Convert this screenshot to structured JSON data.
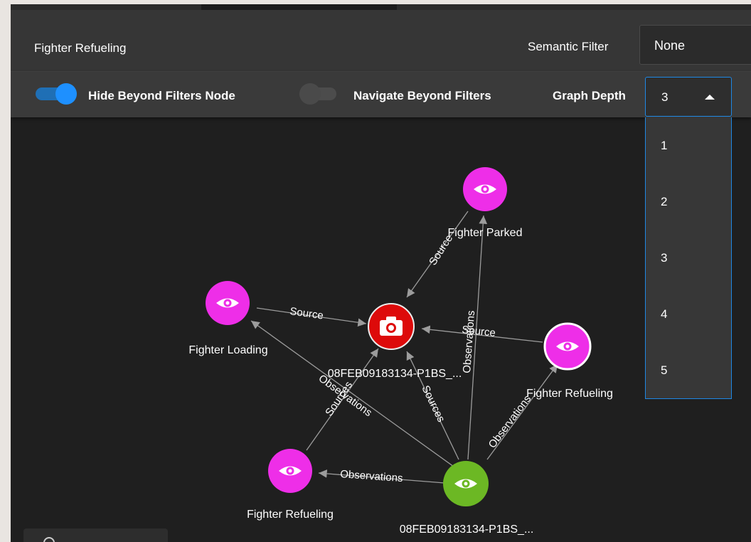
{
  "header": {
    "title": "Fighter Refueling",
    "semantic_filter_label": "Semantic Filter",
    "semantic_filter_value": "None"
  },
  "toolbar": {
    "hide_beyond_label": "Hide Beyond Filters Node",
    "hide_beyond_on": true,
    "navigate_beyond_label": "Navigate Beyond Filters",
    "navigate_beyond_on": false,
    "graph_depth_label": "Graph Depth",
    "graph_depth_value": "3",
    "graph_depth_options": [
      "1",
      "2",
      "3",
      "4",
      "5"
    ]
  },
  "graph": {
    "nodes": {
      "fighter_parked": {
        "label": "Fighter Parked",
        "icon": "eye-icon",
        "color": "#ee2ee8"
      },
      "fighter_loading": {
        "label": "Fighter Loading",
        "icon": "eye-icon",
        "color": "#ee2ee8"
      },
      "image_source": {
        "label": "08FEB09183134-P1BS_...",
        "icon": "camera-icon",
        "color": "#dd0a0a"
      },
      "fighter_refueling_right": {
        "label": "Fighter Refueling",
        "icon": "eye-icon",
        "color": "#ee2ee8"
      },
      "fighter_refueling_left": {
        "label": "Fighter Refueling",
        "icon": "eye-icon",
        "color": "#ee2ee8"
      },
      "center_observation": {
        "label": "08FEB09183134-P1BS_...",
        "icon": "eye-icon",
        "color": "#6cb824"
      }
    },
    "edge_labels": {
      "parked_source": "Source",
      "loading_source": "Source",
      "refueling_source": "Source",
      "center_observations_up": "Observations",
      "center_observations_loading": "Observations",
      "center_sources": "Sources",
      "center_observations_right": "Observations",
      "refueling_left_sources": "Sources",
      "center_observations_left": "Observations"
    }
  }
}
